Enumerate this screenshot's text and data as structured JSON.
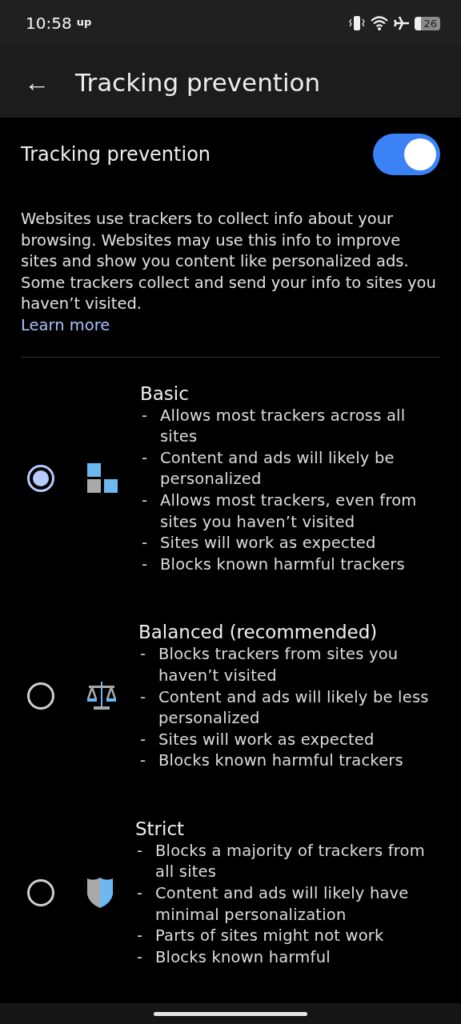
{
  "status_bar": {
    "time": "10:58",
    "carrier": "up",
    "battery": "26"
  },
  "app_bar": {
    "back": "←",
    "title": "Tracking prevention"
  },
  "setting": {
    "label": "Tracking prevention",
    "on": true
  },
  "description": {
    "text": "Websites use trackers to collect info about your browsing. Websites may use this info to improve sites and show you content like personalized ads. Some trackers collect and send your info to sites you haven’t visited.",
    "link": "Learn more"
  },
  "options": [
    {
      "kind": "basic",
      "title": "Basic",
      "selected": true,
      "points": [
        {
          "dash": "-",
          "text": "Allows most trackers across all sites"
        },
        {
          "dash": "-",
          "text": "Content and ads will likely be personalized"
        },
        {
          "dash": "-",
          "text": "Allows most trackers, even from sites you haven’t visited"
        },
        {
          "dash": "-",
          "text": "Sites will work as expected"
        },
        {
          "dash": "-",
          "text": "Blocks known harmful trackers"
        }
      ]
    },
    {
      "kind": "balanced",
      "title": "Balanced (recommended)",
      "selected": false,
      "points": [
        {
          "dash": "-",
          "text": "Blocks trackers from sites you haven’t visited"
        },
        {
          "dash": "-",
          "text": "Content and ads will likely be less personalized"
        },
        {
          "dash": "-",
          "text": "Sites will work as expected"
        },
        {
          "dash": "-",
          "text": "Blocks known harmful trackers"
        }
      ]
    },
    {
      "kind": "strict",
      "title": "Strict",
      "selected": false,
      "points": [
        {
          "dash": "-",
          "text": "Blocks a majority of trackers from all sites"
        },
        {
          "dash": "-",
          "text": "Content and ads will likely have minimal personalization"
        },
        {
          "dash": "-",
          "text": "Parts of sites might not work"
        },
        {
          "dash": "-",
          "text": "Blocks known harmful"
        }
      ]
    }
  ]
}
